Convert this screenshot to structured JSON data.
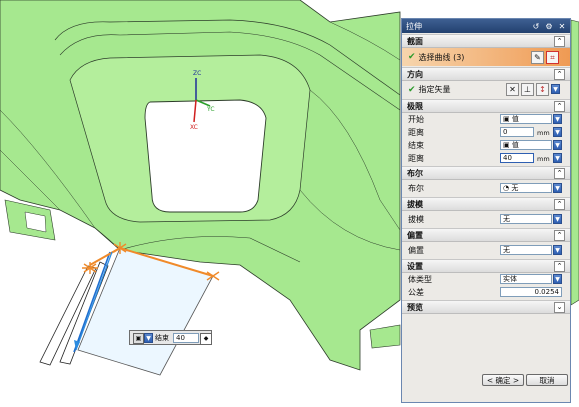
{
  "dialog": {
    "title": "拉伸",
    "sections": {
      "section": "截面",
      "direction": "方向",
      "limits": "极限",
      "boolean": "布尔",
      "draft": "拔模",
      "offset": "偏置",
      "settings": "设置",
      "preview": "预览"
    },
    "select_curve_label": "选择曲线 (3)",
    "specify_vector_label": "指定矢量",
    "limits": {
      "start_label": "开始",
      "start_type": "值",
      "start_distance_label": "距离",
      "start_distance": "0",
      "end_label": "结束",
      "end_type": "值",
      "end_distance_label": "距离",
      "end_distance": "40",
      "unit": "mm"
    },
    "boolean": {
      "label": "布尔",
      "value": "无"
    },
    "draft": {
      "label": "拔模",
      "value": "无"
    },
    "offset": {
      "label": "偏置",
      "value": "无"
    },
    "settings": {
      "body_type_label": "体类型",
      "body_type": "实体",
      "tolerance_label": "公差",
      "tolerance": "0.0254"
    },
    "ok_label": "< 确定 >",
    "cancel_label": "取消"
  },
  "floating": {
    "label": "结束",
    "value": "40"
  },
  "axes": {
    "zc": "ZC",
    "yc": "YC",
    "xc": "XC"
  },
  "colors": {
    "model": "#a6e88f",
    "title_bar": "#2b4a7c",
    "selection": "#f0a060",
    "accent": "#2e5fb2"
  }
}
